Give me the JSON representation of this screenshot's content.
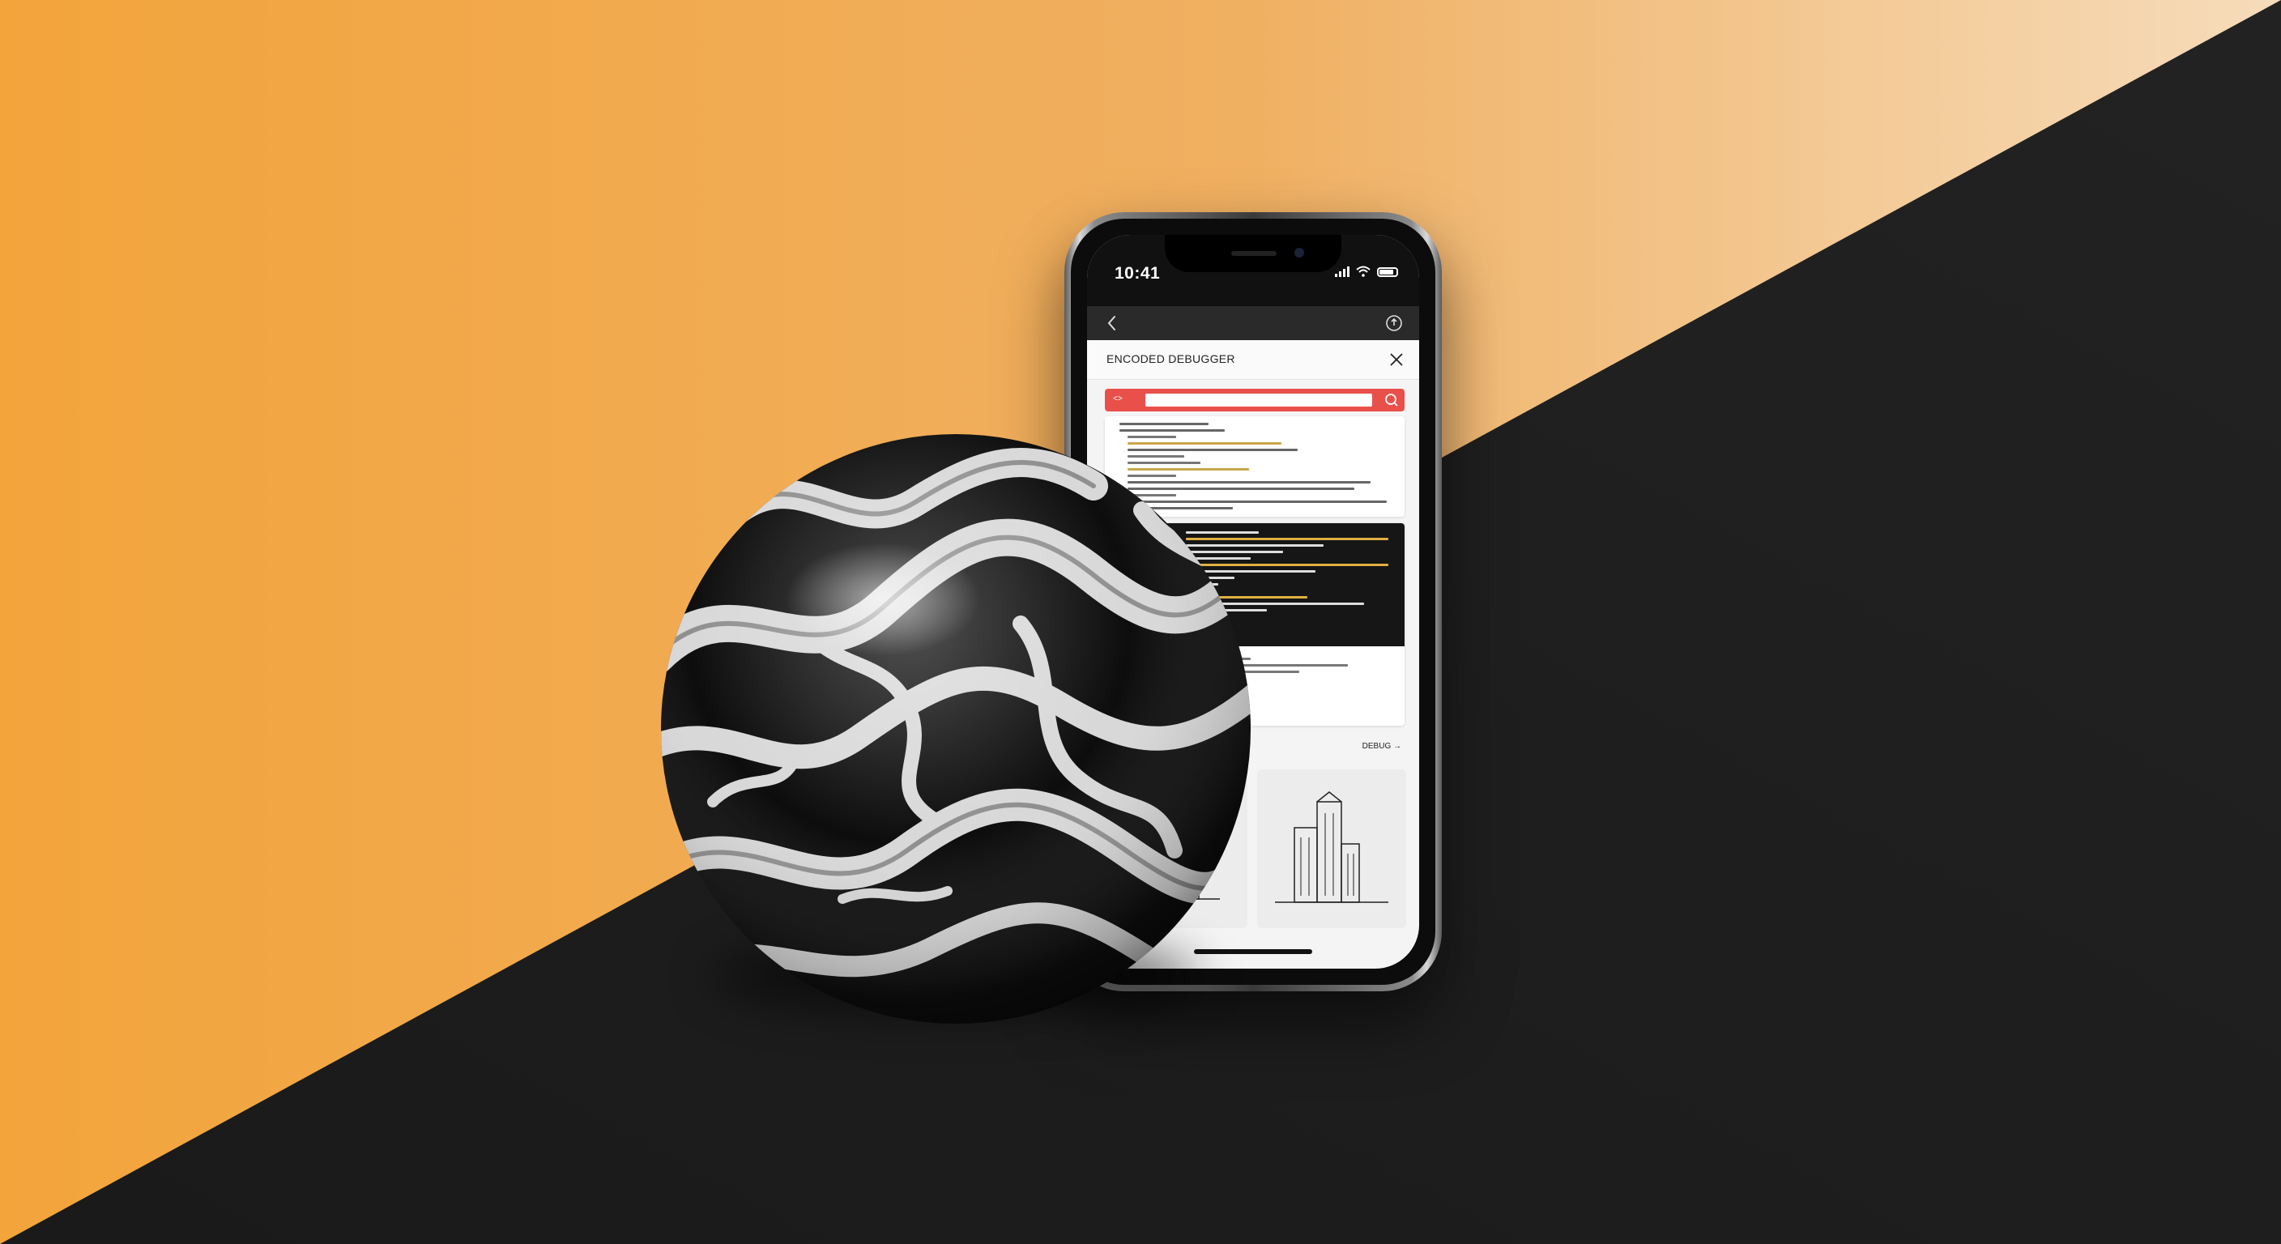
{
  "scene": {
    "colors": {
      "background_orange": "#f2a53f",
      "background_cream": "#f4d6ab",
      "background_black": "#1b1b1b",
      "accent_red": "#e9504a"
    }
  },
  "phone": {
    "status_bar": {
      "time": "10:41",
      "icons": [
        "signal-icon",
        "wifi-icon",
        "battery-icon"
      ]
    },
    "nav": {
      "back_icon": "chevron-left-icon",
      "share_icon": "share-icon"
    },
    "header": {
      "title": "ENCODED DEBUGGER",
      "close_icon": "close-icon"
    },
    "search": {
      "label": "<>",
      "placeholder": "",
      "icon": "search-icon"
    },
    "section": {
      "link_label": "DEBUG →"
    },
    "thumbnails": [
      {
        "icon": "chart-icon"
      },
      {
        "icon": "building-icon"
      }
    ]
  }
}
